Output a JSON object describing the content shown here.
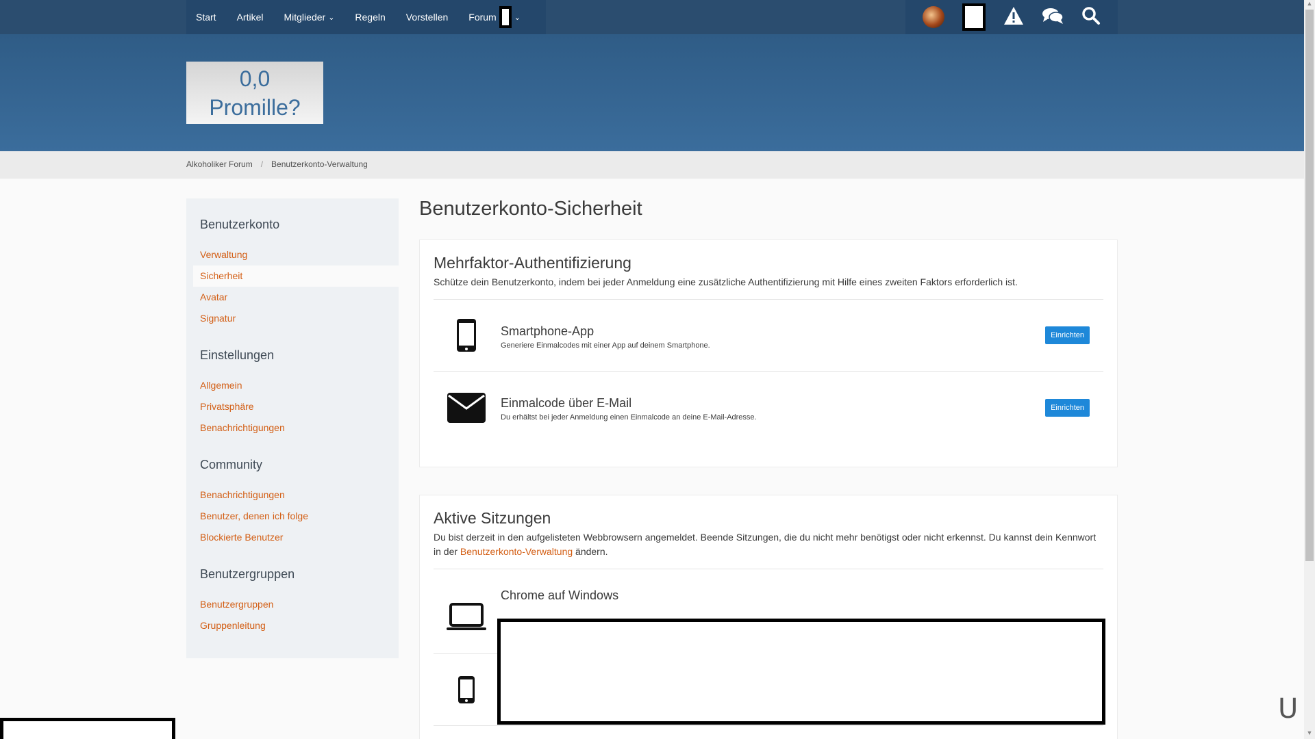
{
  "nav": {
    "items": [
      "Start",
      "Artikel",
      "Mitglieder",
      "Regeln",
      "Vorstellen",
      "Forum"
    ]
  },
  "logo": {
    "line1": "0,0",
    "line2": "Promille?"
  },
  "breadcrumb": [
    "Alkoholiker Forum",
    "Benutzerkonto-Verwaltung"
  ],
  "sidebar": {
    "groups": [
      {
        "title": "Benutzerkonto",
        "links": [
          "Verwaltung",
          "Sicherheit",
          "Avatar",
          "Signatur"
        ]
      },
      {
        "title": "Einstellungen",
        "links": [
          "Allgemein",
          "Privatsphäre",
          "Benachrichtigungen"
        ]
      },
      {
        "title": "Community",
        "links": [
          "Benachrichtigungen",
          "Benutzer, denen ich folge",
          "Blockierte Benutzer"
        ]
      },
      {
        "title": "Benutzergruppen",
        "links": [
          "Benutzergruppen",
          "Gruppenleitung"
        ]
      }
    ]
  },
  "page": {
    "title": "Benutzerkonto-Sicherheit"
  },
  "mfa": {
    "title": "Mehrfaktor-Authentifizierung",
    "desc": "Schütze dein Benutzerkonto, indem bei jeder Anmeldung eine zusätzliche Authentifizierung mit Hilfe eines zweiten Faktors erforderlich ist.",
    "methods": [
      {
        "title": "Smartphone-App",
        "desc": "Generiere Einmalcodes mit einer App auf deinem Smartphone.",
        "button": "Einrichten",
        "icon": "smartphone-icon"
      },
      {
        "title": "Einmalcode über E-Mail",
        "desc": "Du erhältst bei jeder Anmeldung einen Einmalcode an deine E-Mail-Adresse.",
        "button": "Einrichten",
        "icon": "envelope-icon"
      }
    ]
  },
  "sessions": {
    "title": "Aktive Sitzungen",
    "desc_before": "Du bist derzeit in den aufgelisteten Webbrowsern angemeldet. Beende Sitzungen, die du nicht mehr benötigst oder nicht erkennst. Du kannst dein Kennwort in der ",
    "desc_link": "Benutzerkonto-Verwaltung",
    "desc_after": " ändern.",
    "items": [
      {
        "title": "Chrome auf Windows",
        "icon": "laptop-icon"
      }
    ]
  },
  "cursor": "U",
  "colors": {
    "nav": "#24476b",
    "header": "#3b6d9c",
    "link": "#d35e14",
    "button": "#1e88d9"
  }
}
